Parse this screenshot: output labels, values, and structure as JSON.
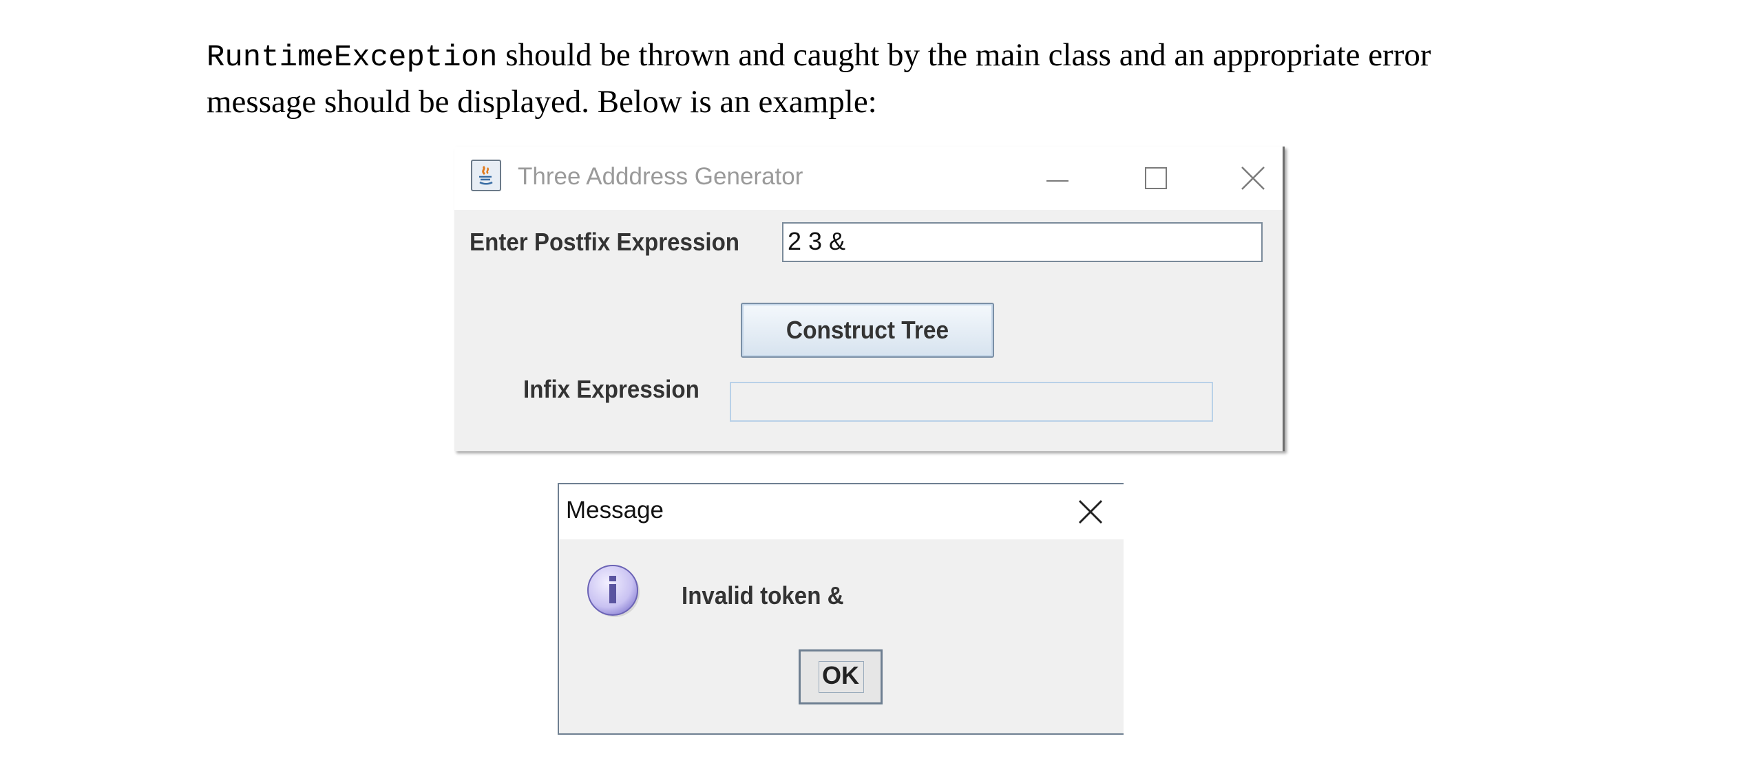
{
  "doc": {
    "code_term": "RuntimeException",
    "line1_rest": " should be thrown and caught by the main class and an appropriate error",
    "line2": "message should be displayed. Below is an example:"
  },
  "main_window": {
    "title": "Three Adddress Generator",
    "icon": "java-app-icon",
    "controls": [
      "minimize-icon",
      "maximize-icon",
      "close-icon"
    ],
    "postfix_label": "Enter Postfix Expression",
    "postfix_value": "2 3 &",
    "construct_button": "Construct Tree",
    "infix_label": "Infix Expression",
    "infix_value": ""
  },
  "message_dialog": {
    "title": "Message",
    "icon": "info-icon",
    "message": "Invalid token &",
    "ok_button": "OK"
  }
}
